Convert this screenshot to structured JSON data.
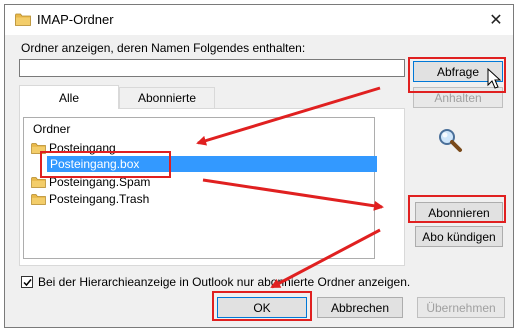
{
  "window": {
    "title": "IMAP-Ordner",
    "close": "✕"
  },
  "filter": {
    "label": "Ordner anzeigen, deren Namen Folgendes enthalten:",
    "value": ""
  },
  "tabs": [
    {
      "label": "Alle"
    },
    {
      "label": "Abonnierte"
    }
  ],
  "tree": {
    "header": "Ordner",
    "items": [
      {
        "label": "Posteingang",
        "selected": false,
        "icon": "folder-icon"
      },
      {
        "label": "Posteingang.box",
        "selected": true,
        "icon": ""
      },
      {
        "label": "Posteingang.Spam",
        "selected": false,
        "icon": "folder-icon"
      },
      {
        "label": "Posteingang.Trash",
        "selected": false,
        "icon": "folder-icon"
      }
    ]
  },
  "buttons": {
    "query": "Abfrage",
    "stop": "Anhalten",
    "subscribe": "Abonnieren",
    "unsubscribe": "Abo kündigen",
    "ok": "OK",
    "cancel": "Abbrechen",
    "apply": "Übernehmen"
  },
  "hierarchy_checkbox": {
    "label": "Bei der Hierarchieanzeige in Outlook nur abonnierte Ordner anzeigen.",
    "checked": true
  },
  "colors": {
    "annotation": "#e02020",
    "selection": "#3399ff",
    "folder": "#e8c25a"
  }
}
